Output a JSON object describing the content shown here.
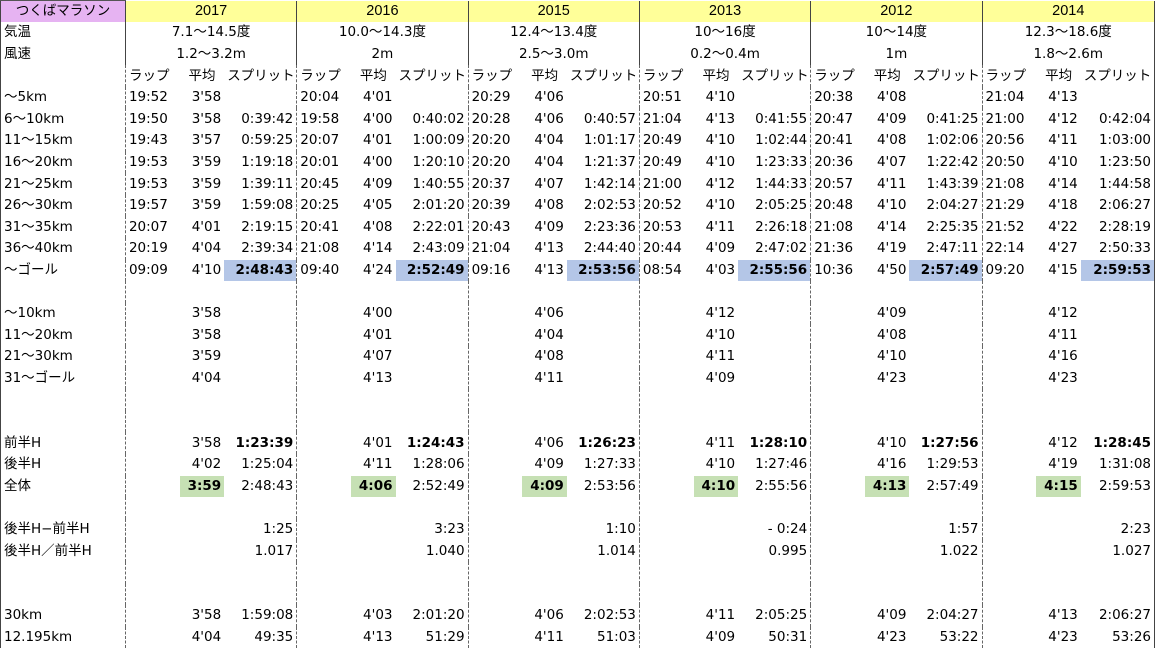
{
  "title": "つくばマラソン",
  "years": [
    "2017",
    "2016",
    "2015",
    "2013",
    "2012",
    "2014"
  ],
  "labels": {
    "temp": "気温",
    "wind": "風速",
    "lap": "ラップ",
    "avg": "平均",
    "split": "スプリット"
  },
  "temp": [
    "7.1〜14.5度",
    "10.0〜14.3度",
    "12.4〜13.4度",
    "10〜16度",
    "10〜14度",
    "12.3〜18.6度"
  ],
  "wind": [
    "1.2〜3.2m",
    "2m",
    "2.5〜3.0m",
    "0.2〜0.4m",
    "1m",
    "1.8〜2.6m"
  ],
  "segments": [
    {
      "label": "〜5km",
      "data": [
        [
          "19:52",
          "3'58",
          ""
        ],
        [
          "20:04",
          "4'01",
          ""
        ],
        [
          "20:29",
          "4'06",
          ""
        ],
        [
          "20:51",
          "4'10",
          ""
        ],
        [
          "20:38",
          "4'08",
          ""
        ],
        [
          "21:04",
          "4'13",
          ""
        ]
      ]
    },
    {
      "label": "6〜10km",
      "data": [
        [
          "19:50",
          "3'58",
          "0:39:42"
        ],
        [
          "19:58",
          "4'00",
          "0:40:02"
        ],
        [
          "20:28",
          "4'06",
          "0:40:57"
        ],
        [
          "21:04",
          "4'13",
          "0:41:55"
        ],
        [
          "20:47",
          "4'09",
          "0:41:25"
        ],
        [
          "21:00",
          "4'12",
          "0:42:04"
        ]
      ]
    },
    {
      "label": "11〜15km",
      "data": [
        [
          "19:43",
          "3'57",
          "0:59:25"
        ],
        [
          "20:07",
          "4'01",
          "1:00:09"
        ],
        [
          "20:20",
          "4'04",
          "1:01:17"
        ],
        [
          "20:49",
          "4'10",
          "1:02:44"
        ],
        [
          "20:41",
          "4'08",
          "1:02:06"
        ],
        [
          "20:56",
          "4'11",
          "1:03:00"
        ]
      ]
    },
    {
      "label": "16〜20km",
      "data": [
        [
          "19:53",
          "3'59",
          "1:19:18"
        ],
        [
          "20:01",
          "4'00",
          "1:20:10"
        ],
        [
          "20:20",
          "4'04",
          "1:21:37"
        ],
        [
          "20:49",
          "4'10",
          "1:23:33"
        ],
        [
          "20:36",
          "4'07",
          "1:22:42"
        ],
        [
          "20:50",
          "4'10",
          "1:23:50"
        ]
      ]
    },
    {
      "label": "21〜25km",
      "data": [
        [
          "19:53",
          "3'59",
          "1:39:11"
        ],
        [
          "20:45",
          "4'09",
          "1:40:55"
        ],
        [
          "20:37",
          "4'07",
          "1:42:14"
        ],
        [
          "21:00",
          "4'12",
          "1:44:33"
        ],
        [
          "20:57",
          "4'11",
          "1:43:39"
        ],
        [
          "21:08",
          "4'14",
          "1:44:58"
        ]
      ]
    },
    {
      "label": "26〜30km",
      "data": [
        [
          "19:57",
          "3'59",
          "1:59:08"
        ],
        [
          "20:25",
          "4'05",
          "2:01:20"
        ],
        [
          "20:39",
          "4'08",
          "2:02:53"
        ],
        [
          "20:52",
          "4'10",
          "2:05:25"
        ],
        [
          "20:48",
          "4'10",
          "2:04:27"
        ],
        [
          "21:29",
          "4'18",
          "2:06:27"
        ]
      ]
    },
    {
      "label": "31〜35km",
      "data": [
        [
          "20:07",
          "4'01",
          "2:19:15"
        ],
        [
          "20:41",
          "4'08",
          "2:22:01"
        ],
        [
          "20:43",
          "4'09",
          "2:23:36"
        ],
        [
          "20:53",
          "4'11",
          "2:26:18"
        ],
        [
          "21:08",
          "4'14",
          "2:25:35"
        ],
        [
          "21:52",
          "4'22",
          "2:28:19"
        ]
      ]
    },
    {
      "label": "36〜40km",
      "data": [
        [
          "20:19",
          "4'04",
          "2:39:34"
        ],
        [
          "21:08",
          "4'14",
          "2:43:09"
        ],
        [
          "21:04",
          "4'13",
          "2:44:40"
        ],
        [
          "20:44",
          "4'09",
          "2:47:02"
        ],
        [
          "21:36",
          "4'19",
          "2:47:11"
        ],
        [
          "22:14",
          "4'27",
          "2:50:33"
        ]
      ]
    },
    {
      "label": "〜ゴール",
      "data": [
        [
          "09:09",
          "4'10",
          "2:48:43"
        ],
        [
          "09:40",
          "4'24",
          "2:52:49"
        ],
        [
          "09:16",
          "4'13",
          "2:53:56"
        ],
        [
          "08:54",
          "4'03",
          "2:55:56"
        ],
        [
          "10:36",
          "4'50",
          "2:57:49"
        ],
        [
          "09:20",
          "4'15",
          "2:59:53"
        ]
      ]
    }
  ],
  "section_avg": [
    {
      "label": "〜10km",
      "data": [
        "3'58",
        "4'00",
        "4'06",
        "4'12",
        "4'09",
        "4'12"
      ]
    },
    {
      "label": "11〜20km",
      "data": [
        "3'58",
        "4'01",
        "4'04",
        "4'10",
        "4'08",
        "4'11"
      ]
    },
    {
      "label": "21〜30km",
      "data": [
        "3'59",
        "4'07",
        "4'08",
        "4'11",
        "4'10",
        "4'16"
      ]
    },
    {
      "label": "31〜ゴール",
      "data": [
        "4'04",
        "4'13",
        "4'11",
        "4'09",
        "4'23",
        "4'23"
      ]
    }
  ],
  "halves": [
    {
      "label": "前半H",
      "data": [
        [
          "3'58",
          "1:23:39"
        ],
        [
          "4'01",
          "1:24:43"
        ],
        [
          "4'06",
          "1:26:23"
        ],
        [
          "4'11",
          "1:28:10"
        ],
        [
          "4'10",
          "1:27:56"
        ],
        [
          "4'12",
          "1:28:45"
        ]
      ]
    },
    {
      "label": "後半H",
      "data": [
        [
          "4'02",
          "1:25:04"
        ],
        [
          "4'11",
          "1:28:06"
        ],
        [
          "4'09",
          "1:27:33"
        ],
        [
          "4'10",
          "1:27:46"
        ],
        [
          "4'16",
          "1:29:53"
        ],
        [
          "4'19",
          "1:31:08"
        ]
      ]
    },
    {
      "label": "全体",
      "data": [
        [
          "3:59",
          "2:48:43"
        ],
        [
          "4:06",
          "2:52:49"
        ],
        [
          "4:09",
          "2:53:56"
        ],
        [
          "4:10",
          "2:55:56"
        ],
        [
          "4:13",
          "2:57:49"
        ],
        [
          "4:15",
          "2:59:53"
        ]
      ]
    }
  ],
  "diffs": [
    {
      "label": "後半H−前半H",
      "data": [
        "1:25",
        "3:23",
        "1:10",
        "- 0:24",
        "1:57",
        "2:23"
      ]
    },
    {
      "label": "後半H／前半H",
      "data": [
        "1.017",
        "1.040",
        "1.014",
        "0.995",
        "1.022",
        "1.027"
      ]
    }
  ],
  "distances": [
    {
      "label": "30km",
      "data": [
        [
          "3'58",
          "1:59:08"
        ],
        [
          "4'03",
          "2:01:20"
        ],
        [
          "4'06",
          "2:02:53"
        ],
        [
          "4'11",
          "2:05:25"
        ],
        [
          "4'09",
          "2:04:27"
        ],
        [
          "4'13",
          "2:06:27"
        ]
      ]
    },
    {
      "label": "12.195km",
      "data": [
        [
          "4'04",
          "49:35"
        ],
        [
          "4'13",
          "51:29"
        ],
        [
          "4'11",
          "51:03"
        ],
        [
          "4'09",
          "50:31"
        ],
        [
          "4'23",
          "53:22"
        ],
        [
          "4'23",
          "53:26"
        ]
      ]
    }
  ],
  "colors": {
    "title_bg": "#e6b3f2",
    "year_bg": "#ffff99",
    "finish_highlight": "#b4c6e7",
    "overall_avg_highlight": "#c6e0b4"
  }
}
